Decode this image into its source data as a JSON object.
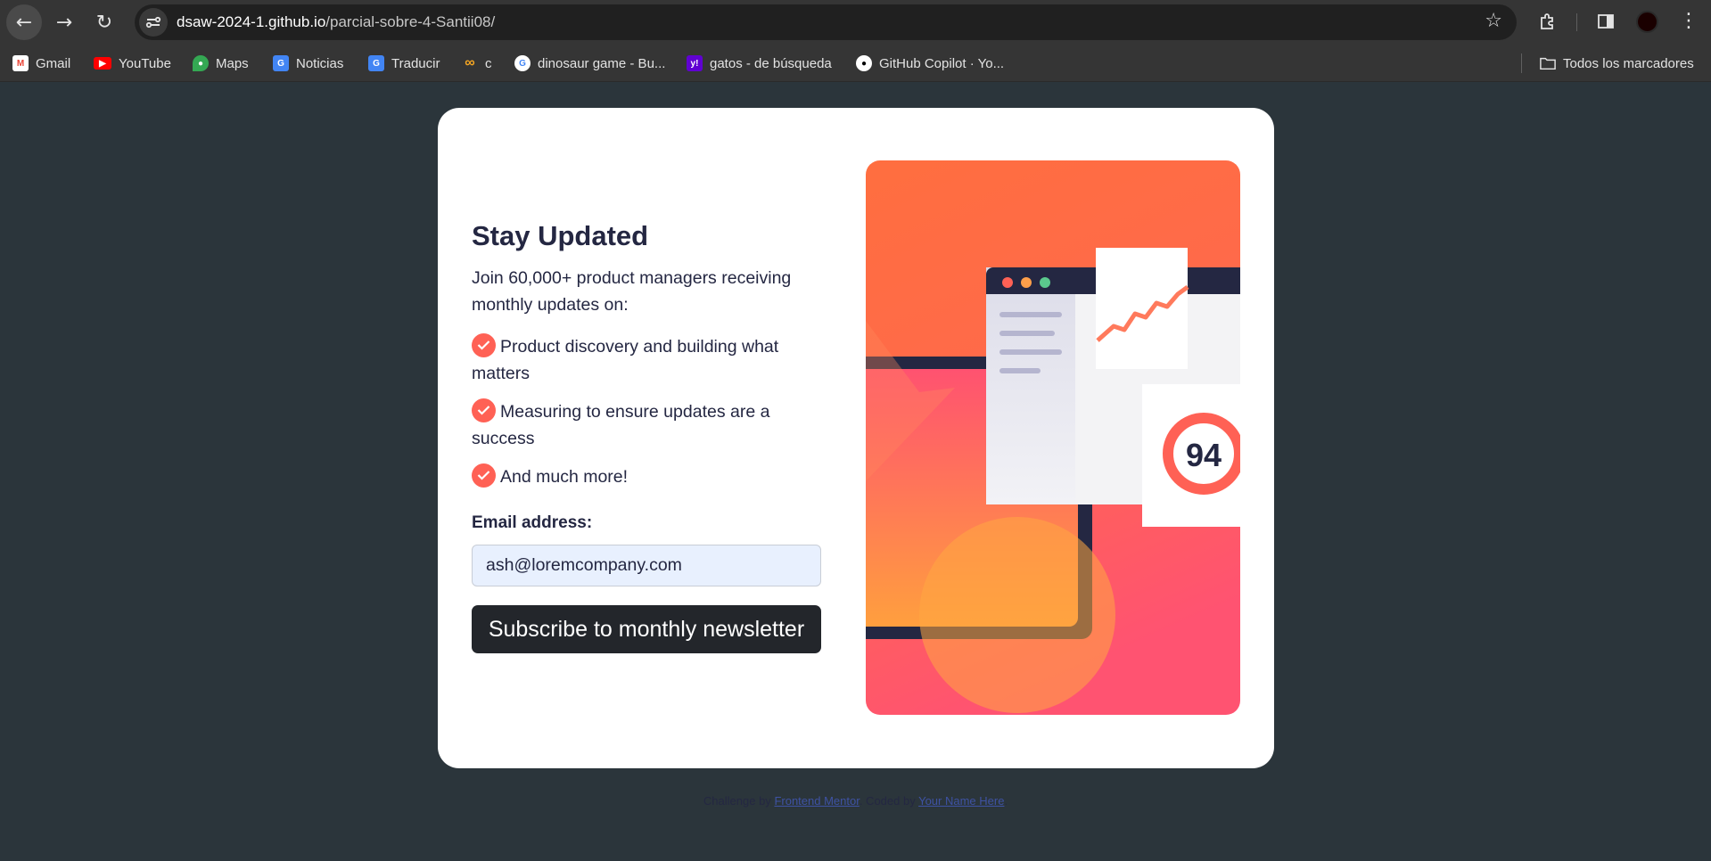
{
  "browser": {
    "url_host": "dsaw-2024-1.github.io",
    "url_path": "/parcial-sobre-4-Santii08/",
    "bookmarks": [
      {
        "label": "Gmail",
        "icon": "gmail-icon",
        "color": "#ea4335"
      },
      {
        "label": "YouTube",
        "icon": "youtube-icon",
        "color": "#ff0000"
      },
      {
        "label": "Maps",
        "icon": "maps-icon",
        "color": "#34a853"
      },
      {
        "label": "Noticias",
        "icon": "news-icon",
        "color": "#4285f4"
      },
      {
        "label": "Traducir",
        "icon": "translate-icon",
        "color": "#4285f4"
      },
      {
        "label": "c",
        "icon": "infinity-icon",
        "color": "#f5a623"
      },
      {
        "label": "dinosaur game - Bu...",
        "icon": "google-icon",
        "color": "#ffffff"
      },
      {
        "label": "gatos - de búsqueda",
        "icon": "yahoo-icon",
        "color": "#6001d2"
      },
      {
        "label": "GitHub Copilot · Yo...",
        "icon": "github-icon",
        "color": "#ffffff"
      }
    ],
    "all_bookmarks_label": "Todos los marcadores"
  },
  "newsletter": {
    "title": "Stay Updated",
    "lead": "Join 60,000+ product managers receiving monthly updates on:",
    "features": [
      "Product discovery and building what matters",
      "Measuring to ensure updates are a success",
      "And much more!"
    ],
    "email_label": "Email address:",
    "email_value": "ash@loremcompany.com",
    "subscribe_label": "Subscribe to monthly newsletter",
    "illustration_score": "94",
    "accent_color": "#ff6155",
    "dark_color": "#242742"
  },
  "attribution": {
    "prefix": "Challenge by",
    "link1": "Frontend Mentor",
    "middle": ". Coded by",
    "link2": "Your Name Here",
    "suffix": "."
  }
}
